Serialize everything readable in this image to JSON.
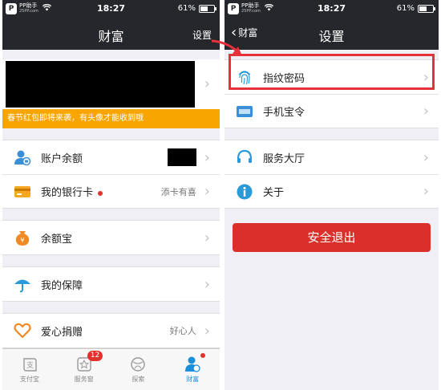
{
  "status": {
    "carrier_logo": "P",
    "carrier_name": "PP助手",
    "carrier_sub": "25PP.com",
    "time": "18:27",
    "battery": "61%",
    "battery_level": 0.61
  },
  "left": {
    "nav_title": "财富",
    "nav_right": "设置",
    "notice": "春节红包即将来袭，有头像才能收到哦",
    "rows": [
      {
        "label": "账户余额",
        "icon": "account-icon"
      },
      {
        "label": "我的银行卡",
        "value": "添卡有喜",
        "icon": "bank-card-icon"
      },
      {
        "label": "余额宝",
        "icon": "yuebao-icon"
      },
      {
        "label": "我的保障",
        "icon": "umbrella-icon"
      },
      {
        "label": "爱心捐赠",
        "value": "好心人",
        "icon": "heart-icon"
      }
    ],
    "tabs": [
      {
        "label": "支付宝",
        "icon": "alipay-icon"
      },
      {
        "label": "服务窗",
        "icon": "service-window-icon",
        "badge": "12"
      },
      {
        "label": "探索",
        "icon": "explore-icon"
      },
      {
        "label": "财富",
        "icon": "wealth-icon"
      }
    ]
  },
  "right": {
    "back_label": "财富",
    "nav_title": "设置",
    "rows": [
      {
        "label": "指纹密码",
        "icon": "fingerprint-icon"
      },
      {
        "label": "手机宝令",
        "icon": "phone-token-icon"
      },
      {
        "label": "服务大厅",
        "icon": "headset-icon"
      },
      {
        "label": "关于",
        "icon": "info-icon"
      }
    ],
    "logout_label": "安全退出"
  },
  "colors": {
    "navbar": "#26272c",
    "notice": "#f8a500",
    "accent_blue": "#1c8ed9",
    "logout": "#db3029",
    "highlight": "#e5313a"
  }
}
